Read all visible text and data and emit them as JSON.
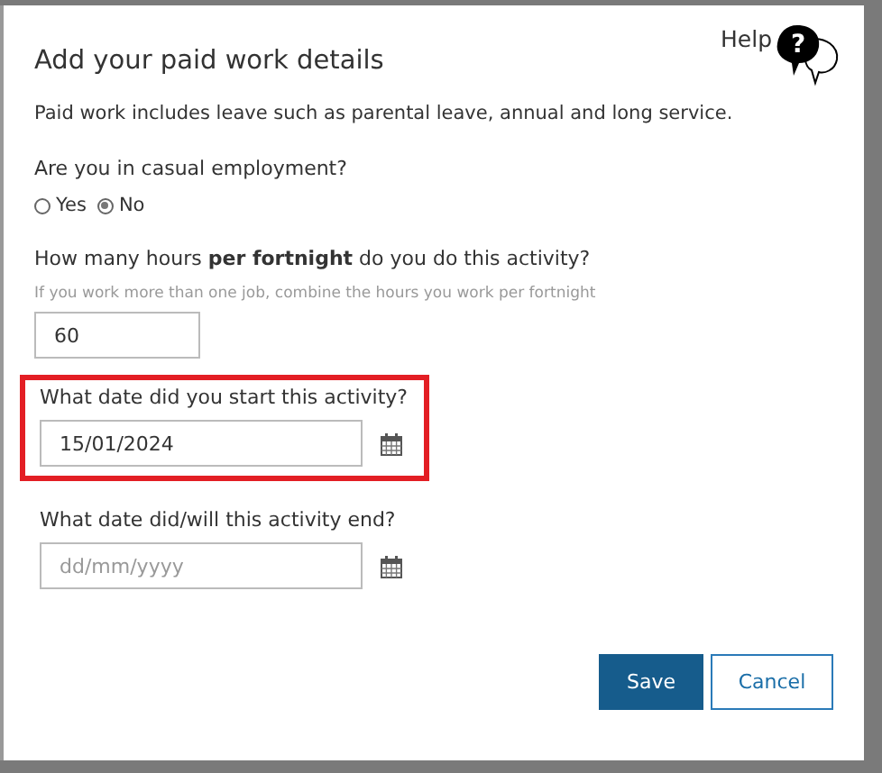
{
  "dialog": {
    "title": "Add your paid work details",
    "help_label": "Help",
    "help_icon_glyph": "?",
    "intro": "Paid work includes leave such as parental leave, annual and long service."
  },
  "casual_question": {
    "label": "Are you in casual employment?",
    "options": [
      {
        "label": "Yes",
        "selected": false
      },
      {
        "label": "No",
        "selected": true
      }
    ]
  },
  "hours": {
    "label": "How many hours **per fortnight** do you do this activity?",
    "hint": "If you work more than one job, combine the hours you work per fortnight",
    "value": "60"
  },
  "dates": [
    {
      "label": "What date did you start this activity?",
      "value": "15/01/2024",
      "highlighted": true
    },
    {
      "label": "What date did/will this activity end?",
      "placeholder": "dd/mm/yyyy",
      "highlighted": false
    }
  ],
  "buttons": [
    {
      "label": "Save",
      "kind": "primary"
    },
    {
      "label": "Cancel",
      "kind": "secondary"
    }
  ]
}
